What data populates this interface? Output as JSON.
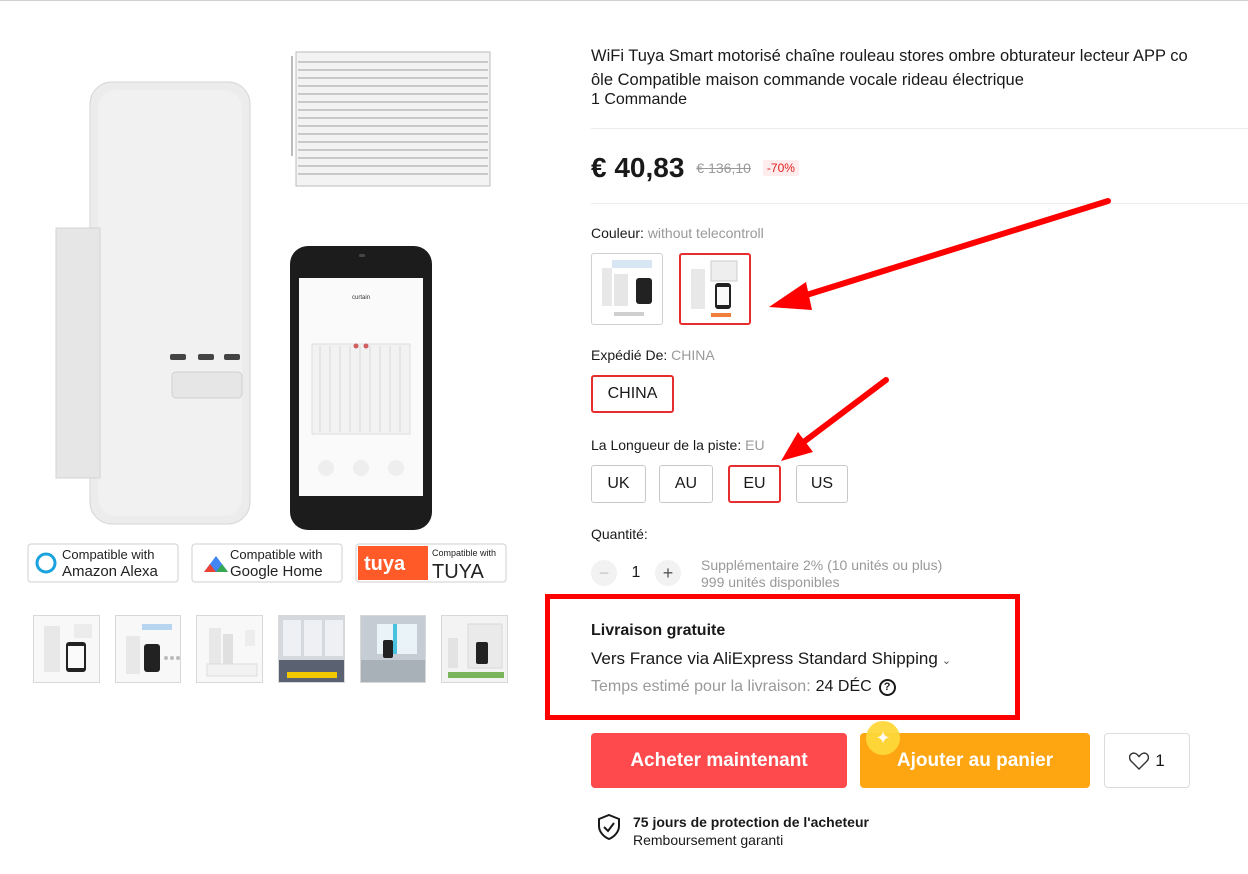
{
  "product": {
    "title_line1": "WiFi Tuya Smart motorisé chaîne rouleau stores ombre obturateur lecteur APP co",
    "title_line2": "ôle Compatible maison commande vocale rideau électrique",
    "orders": "1 Commande",
    "price": "€ 40,83",
    "old_price": "€ 136,10",
    "discount": "-70%"
  },
  "gallery": {
    "badges": {
      "alexa_top": "Compatible with",
      "alexa_bottom": "Amazon Alexa",
      "google_top": "Compatible with",
      "google_bottom": "Google Home",
      "tuya_logo": "tuya",
      "tuya_top": "Compatible with",
      "tuya_bottom": "TUYA"
    },
    "phone_screen_title": "curtain",
    "thumbnails": [
      "thumb-1",
      "thumb-2",
      "thumb-3",
      "thumb-4",
      "thumb-5",
      "thumb-6"
    ]
  },
  "options": {
    "color_label": "Couleur:",
    "color_value": "without telecontroll",
    "ship_from_label": "Expédié De:",
    "ship_from_value": "CHINA",
    "ship_from_chip": "CHINA",
    "track_label": "La Longueur de la piste:",
    "track_value": "EU",
    "track_options": [
      "UK",
      "AU",
      "EU",
      "US"
    ],
    "selected_track": "EU"
  },
  "quantity": {
    "label": "Quantité:",
    "value": "1",
    "minus": "−",
    "plus": "+",
    "note_line1": "Supplémentaire 2% (10 unités ou plus)",
    "note_line2": "999 unités disponibles"
  },
  "shipping": {
    "title": "Livraison gratuite",
    "line": "Vers France via AliExpress Standard Shipping",
    "eta_label": "Temps estimé pour la livraison:",
    "eta_date": "24 DÉC"
  },
  "actions": {
    "buy_now": "Acheter maintenant",
    "add_to_cart": "Ajouter au panier",
    "wishlist_count": "1"
  },
  "protection": {
    "title": "75 jours de protection de l'acheteur",
    "subtitle": "Remboursement garanti"
  },
  "colors": {
    "accent_red": "#fe4a4c",
    "accent_orange": "#fea512",
    "annotation_red": "#ff0000",
    "selected_border": "#e62e2e"
  }
}
